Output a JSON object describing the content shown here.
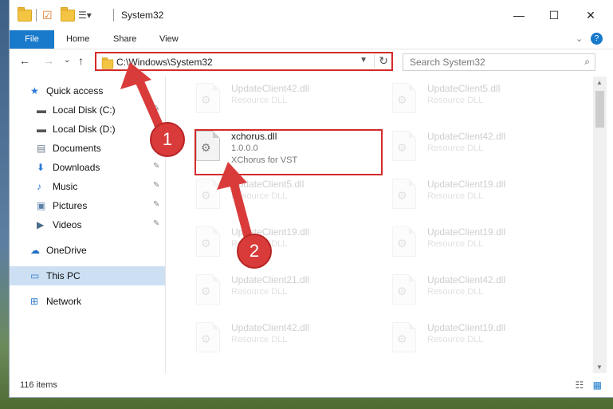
{
  "window": {
    "title": "System32",
    "controls": {
      "minimize": "—",
      "maximize": "☐",
      "close": "✕"
    }
  },
  "ribbon": {
    "tabs": [
      "File",
      "Home",
      "Share",
      "View"
    ],
    "help": "?",
    "collapse": "⌄"
  },
  "nav": {
    "back": "←",
    "forward": "→",
    "recent": "⌄",
    "up": "↑",
    "address": "C:\\Windows\\System32",
    "search_placeholder": "Search System32"
  },
  "sidebar": {
    "items": [
      {
        "label": "Quick access",
        "icon": "star-icon",
        "sub": false,
        "pin": false
      },
      {
        "label": "Local Disk (C:)",
        "icon": "drive-icon",
        "sub": true,
        "pin": true
      },
      {
        "label": "Local Disk (D:)",
        "icon": "drive-icon",
        "sub": true,
        "pin": true
      },
      {
        "label": "Documents",
        "icon": "documents-icon",
        "sub": true,
        "pin": true
      },
      {
        "label": "Downloads",
        "icon": "download-icon",
        "sub": true,
        "pin": true
      },
      {
        "label": "Music",
        "icon": "music-icon",
        "sub": true,
        "pin": true
      },
      {
        "label": "Pictures",
        "icon": "pictures-icon",
        "sub": true,
        "pin": true
      },
      {
        "label": "Videos",
        "icon": "videos-icon",
        "sub": true,
        "pin": true
      },
      {
        "label": "OneDrive",
        "icon": "cloud-icon",
        "sub": false,
        "pin": false
      },
      {
        "label": "This PC",
        "icon": "computer-icon",
        "sub": false,
        "pin": false,
        "active": true
      },
      {
        "label": "Network",
        "icon": "network-icon",
        "sub": false,
        "pin": false
      }
    ]
  },
  "files": {
    "left": [
      {
        "name": "UpdateClient42.dll",
        "type": "Resource DLL"
      },
      {
        "name": "xchorus.dll",
        "version": "1.0.0.0",
        "type": "XChorus for VST",
        "highlight": true
      },
      {
        "name": "UpdateClient5.dll",
        "type": "Resource DLL"
      },
      {
        "name": "UpdateClient19.dll",
        "type": "Resource DLL"
      },
      {
        "name": "UpdateClient21.dll",
        "type": "Resource DLL"
      },
      {
        "name": "UpdateClient42.dll",
        "type": "Resource DLL"
      }
    ],
    "right": [
      {
        "name": "UpdateClient5.dll",
        "type": "Resource DLL"
      },
      {
        "name": "UpdateClient42.dll",
        "type": "Resource DLL"
      },
      {
        "name": "UpdateClient19.dll",
        "type": "Resource DLL"
      },
      {
        "name": "UpdateClient19.dll",
        "type": "Resource DLL"
      },
      {
        "name": "UpdateClient42.dll",
        "type": "Resource DLL"
      },
      {
        "name": "UpdateClient19.dll",
        "type": "Resource DLL"
      }
    ]
  },
  "status": {
    "count": "116 items"
  },
  "annotations": {
    "badge1": "1",
    "badge2": "2"
  },
  "colors": {
    "accent": "#1979ca",
    "highlight": "#d42a2a",
    "selection": "#ccdff3"
  }
}
